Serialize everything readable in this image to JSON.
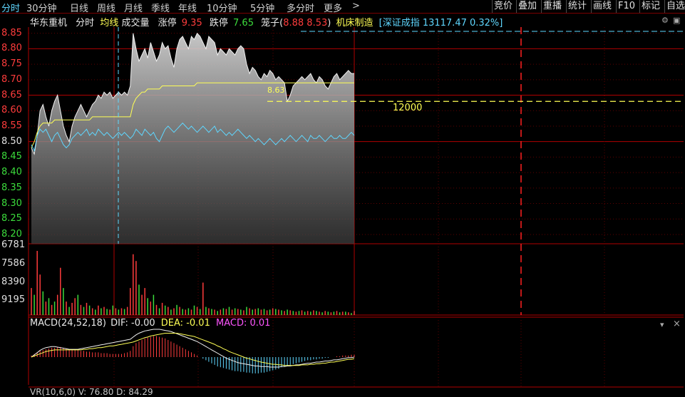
{
  "tabs": {
    "left": [
      "分时",
      "30分钟",
      "日线",
      "周线",
      "月线",
      "季线",
      "年线",
      "10分钟",
      "5分钟",
      "多分时",
      "更多",
      ">"
    ],
    "right": [
      "竞价",
      "叠加",
      "重播",
      "统计",
      "画线",
      "F10",
      "标记",
      "自选"
    ]
  },
  "info": {
    "name": "华东重机",
    "mode": "分时",
    "avg_label": "均线",
    "vol_label": "成交量",
    "limit_up_label": "涨停",
    "limit_up": "9.35",
    "limit_down_label": "跌停",
    "limit_down": "7.65",
    "cage_label": "笼子(",
    "cage_low": "8.88",
    "cage_high": "8.53",
    "cage_close": ")",
    "industry": "机床制造",
    "index_text": "[深证成指 13117.47 0.32%]"
  },
  "colors": {
    "up": "#ff3c3c",
    "down": "#3cdc3c",
    "avg": "#ffff55",
    "cyan": "#5fd7ff",
    "grid": "#b00000",
    "magenta": "#ff55ff"
  },
  "price_axis": [
    "8.85",
    "8.80",
    "8.75",
    "8.70",
    "8.65",
    "8.60",
    "8.55",
    "8.50",
    "8.45",
    "8.40",
    "8.35",
    "8.30",
    "8.25",
    "8.20"
  ],
  "volume_axis": [
    "6781",
    "7586",
    "8390",
    "9195"
  ],
  "annotations": {
    "price_mark": "8.63",
    "order_qty": "12000"
  },
  "macd": {
    "title": "MACD(24,52,18)",
    "dif_label": "DIF:",
    "dif": "-0.00",
    "dea_label": "DEA:",
    "dea": "-0.01",
    "macd_label": "MACD:",
    "macd": "0.01"
  },
  "bottom": "VR(10,6,0) V: 76.80  D: 84.29",
  "chart_data": {
    "type": "line",
    "ylim": [
      8.17,
      8.87
    ],
    "price": [
      8.48,
      8.46,
      8.52,
      8.6,
      8.62,
      8.58,
      8.55,
      8.6,
      8.63,
      8.65,
      8.6,
      8.55,
      8.52,
      8.5,
      8.55,
      8.58,
      8.6,
      8.62,
      8.6,
      8.58,
      8.6,
      8.62,
      8.63,
      8.65,
      8.64,
      8.66,
      8.65,
      8.66,
      8.64,
      8.65,
      8.66,
      8.65,
      8.66,
      8.65,
      8.68,
      8.85,
      8.8,
      8.76,
      8.78,
      8.8,
      8.77,
      8.82,
      8.79,
      8.76,
      8.78,
      8.82,
      8.8,
      8.81,
      8.77,
      8.74,
      8.8,
      8.83,
      8.84,
      8.82,
      8.8,
      8.84,
      8.83,
      8.85,
      8.84,
      8.82,
      8.8,
      8.84,
      8.83,
      8.82,
      8.78,
      8.8,
      8.79,
      8.78,
      8.8,
      8.79,
      8.78,
      8.8,
      8.81,
      8.8,
      8.75,
      8.72,
      8.74,
      8.73,
      8.71,
      8.7,
      8.72,
      8.71,
      8.73,
      8.72,
      8.7,
      8.71,
      8.7,
      8.69,
      8.63,
      8.65,
      8.68,
      8.69,
      8.7,
      8.71,
      8.7,
      8.71,
      8.72,
      8.7,
      8.69,
      8.71,
      8.7,
      8.68,
      8.67,
      8.69,
      8.71,
      8.72,
      8.7,
      8.71,
      8.72,
      8.73,
      8.72,
      8.72
    ],
    "avg": [
      8.48,
      8.5,
      8.53,
      8.55,
      8.56,
      8.56,
      8.56,
      8.56,
      8.57,
      8.57,
      8.57,
      8.57,
      8.57,
      8.57,
      8.57,
      8.57,
      8.57,
      8.57,
      8.57,
      8.57,
      8.57,
      8.58,
      8.58,
      8.58,
      8.58,
      8.58,
      8.58,
      8.58,
      8.58,
      8.58,
      8.58,
      8.58,
      8.58,
      8.58,
      8.58,
      8.62,
      8.64,
      8.65,
      8.66,
      8.66,
      8.67,
      8.67,
      8.67,
      8.67,
      8.67,
      8.68,
      8.68,
      8.68,
      8.68,
      8.68,
      8.68,
      8.68,
      8.68,
      8.68,
      8.68,
      8.68,
      8.68,
      8.69,
      8.69,
      8.69,
      8.69,
      8.69,
      8.69,
      8.69,
      8.69,
      8.69,
      8.69,
      8.69,
      8.69,
      8.69,
      8.69,
      8.69,
      8.69,
      8.69,
      8.69,
      8.69,
      8.69,
      8.69,
      8.69,
      8.69,
      8.69,
      8.69,
      8.69,
      8.69,
      8.69,
      8.69,
      8.69,
      8.69,
      8.69,
      8.69,
      8.69,
      8.69,
      8.69,
      8.69,
      8.69,
      8.69,
      8.69,
      8.69,
      8.69,
      8.69,
      8.69,
      8.69,
      8.69,
      8.69,
      8.69,
      8.69,
      8.69,
      8.69,
      8.69,
      8.69,
      8.69,
      8.69
    ],
    "index": [
      8.49,
      8.47,
      8.52,
      8.54,
      8.53,
      8.54,
      8.52,
      8.5,
      8.52,
      8.53,
      8.51,
      8.49,
      8.48,
      8.49,
      8.51,
      8.52,
      8.53,
      8.52,
      8.53,
      8.54,
      8.52,
      8.53,
      8.52,
      8.54,
      8.53,
      8.52,
      8.53,
      8.52,
      8.51,
      8.52,
      8.53,
      8.52,
      8.53,
      8.52,
      8.51,
      8.52,
      8.54,
      8.53,
      8.52,
      8.54,
      8.53,
      8.52,
      8.53,
      8.51,
      8.5,
      8.52,
      8.54,
      8.55,
      8.54,
      8.53,
      8.54,
      8.55,
      8.56,
      8.55,
      8.54,
      8.55,
      8.54,
      8.53,
      8.54,
      8.55,
      8.54,
      8.53,
      8.54,
      8.55,
      8.53,
      8.54,
      8.53,
      8.52,
      8.53,
      8.52,
      8.53,
      8.54,
      8.53,
      8.52,
      8.51,
      8.52,
      8.51,
      8.5,
      8.51,
      8.5,
      8.49,
      8.5,
      8.51,
      8.5,
      8.49,
      8.5,
      8.51,
      8.5,
      8.51,
      8.52,
      8.51,
      8.5,
      8.51,
      8.52,
      8.51,
      8.5,
      8.52,
      8.51,
      8.51,
      8.52,
      8.51,
      8.5,
      8.51,
      8.52,
      8.51,
      8.51,
      8.52,
      8.51,
      8.51,
      8.52,
      8.53,
      8.52
    ],
    "volume": [
      40,
      30,
      95,
      60,
      35,
      20,
      25,
      15,
      20,
      30,
      70,
      40,
      20,
      12,
      18,
      25,
      30,
      15,
      12,
      18,
      14,
      10,
      8,
      14,
      10,
      12,
      9,
      8,
      14,
      10,
      8,
      10,
      9,
      12,
      40,
      90,
      80,
      45,
      30,
      40,
      25,
      20,
      30,
      15,
      10,
      18,
      14,
      12,
      8,
      10,
      15,
      12,
      9,
      8,
      10,
      8,
      14,
      12,
      9,
      48,
      12,
      10,
      9,
      8,
      6,
      8,
      10,
      9,
      12,
      8,
      10,
      9,
      8,
      7,
      12,
      10,
      8,
      9,
      10,
      8,
      9,
      7,
      8,
      10,
      9,
      8,
      7,
      6,
      8,
      7,
      6,
      5,
      6,
      7,
      5,
      6,
      5,
      7,
      6,
      5,
      4,
      6,
      5,
      4,
      5,
      6,
      4,
      5,
      5,
      4,
      3,
      6
    ],
    "volume_up": [
      true,
      false,
      true,
      true,
      false,
      true,
      false,
      true,
      false,
      true,
      true,
      false,
      true,
      false,
      true,
      true,
      false,
      true,
      false,
      true,
      false,
      true,
      false,
      true,
      false,
      true,
      false,
      true,
      false,
      true,
      false,
      true,
      false,
      true,
      true,
      true,
      true,
      false,
      true,
      true,
      false,
      true,
      false,
      true,
      false,
      true,
      false,
      true,
      false,
      true,
      false,
      true,
      false,
      true,
      false,
      true,
      false,
      true,
      false,
      true,
      false,
      true,
      false,
      true,
      false,
      true,
      false,
      true,
      false,
      true,
      false,
      true,
      false,
      true,
      false,
      true,
      false,
      true,
      false,
      true,
      false,
      true,
      false,
      true,
      false,
      true,
      false,
      true,
      false,
      true,
      false,
      true,
      false,
      true,
      false,
      true,
      false,
      true,
      false,
      true,
      false,
      true,
      false,
      true,
      false,
      true,
      false,
      true,
      false,
      true,
      false,
      true
    ],
    "macd_hist": [
      0.002,
      0.004,
      0.006,
      0.008,
      0.009,
      0.01,
      0.011,
      0.012,
      0.012,
      0.013,
      0.013,
      0.012,
      0.011,
      0.01,
      0.01,
      0.009,
      0.009,
      0.008,
      0.008,
      0.007,
      0.007,
      0.006,
      0.006,
      0.006,
      0.005,
      0.005,
      0.005,
      0.004,
      0.004,
      0.004,
      0.004,
      0.004,
      0.005,
      0.006,
      0.008,
      0.014,
      0.018,
      0.02,
      0.022,
      0.024,
      0.025,
      0.026,
      0.027,
      0.027,
      0.026,
      0.025,
      0.024,
      0.022,
      0.02,
      0.018,
      0.016,
      0.014,
      0.012,
      0.01,
      0.008,
      0.006,
      0.004,
      0.002,
      0.0,
      -0.002,
      -0.004,
      -0.006,
      -0.008,
      -0.01,
      -0.012,
      -0.013,
      -0.014,
      -0.015,
      -0.016,
      -0.017,
      -0.018,
      -0.018,
      -0.019,
      -0.019,
      -0.02,
      -0.02,
      -0.021,
      -0.021,
      -0.021,
      -0.02,
      -0.02,
      -0.019,
      -0.018,
      -0.017,
      -0.016,
      -0.015,
      -0.013,
      -0.012,
      -0.011,
      -0.01,
      -0.009,
      -0.008,
      -0.007,
      -0.006,
      -0.005,
      -0.004,
      -0.004,
      -0.003,
      -0.003,
      -0.002,
      -0.002,
      -0.001,
      -0.001,
      0.0,
      0.0,
      0.001,
      0.001,
      0.002,
      0.002,
      0.002,
      0.003,
      0.003
    ],
    "macd_dif": [
      0.0,
      0.004,
      0.008,
      0.012,
      0.015,
      0.017,
      0.018,
      0.019,
      0.019,
      0.018,
      0.017,
      0.016,
      0.015,
      0.014,
      0.014,
      0.014,
      0.014,
      0.015,
      0.016,
      0.017,
      0.018,
      0.019,
      0.02,
      0.021,
      0.022,
      0.023,
      0.024,
      0.025,
      0.026,
      0.027,
      0.028,
      0.029,
      0.03,
      0.031,
      0.032,
      0.036,
      0.04,
      0.043,
      0.045,
      0.047,
      0.048,
      0.049,
      0.05,
      0.05,
      0.05,
      0.049,
      0.048,
      0.047,
      0.046,
      0.044,
      0.042,
      0.04,
      0.038,
      0.036,
      0.034,
      0.032,
      0.03,
      0.028,
      0.025,
      0.022,
      0.019,
      0.016,
      0.013,
      0.01,
      0.007,
      0.004,
      0.001,
      -0.002,
      -0.004,
      -0.006,
      -0.008,
      -0.01,
      -0.011,
      -0.012,
      -0.013,
      -0.014,
      -0.015,
      -0.016,
      -0.016,
      -0.017,
      -0.017,
      -0.017,
      -0.018,
      -0.018,
      -0.018,
      -0.018,
      -0.017,
      -0.017,
      -0.016,
      -0.016,
      -0.015,
      -0.014,
      -0.014,
      -0.013,
      -0.012,
      -0.011,
      -0.011,
      -0.01,
      -0.009,
      -0.009,
      -0.008,
      -0.007,
      -0.007,
      -0.006,
      -0.005,
      -0.005,
      -0.004,
      -0.003,
      -0.002,
      -0.001,
      -0.001,
      0.0
    ],
    "macd_dea": [
      0.0,
      0.002,
      0.004,
      0.006,
      0.008,
      0.01,
      0.011,
      0.012,
      0.013,
      0.013,
      0.013,
      0.013,
      0.013,
      0.013,
      0.013,
      0.013,
      0.013,
      0.013,
      0.014,
      0.014,
      0.015,
      0.015,
      0.016,
      0.017,
      0.017,
      0.018,
      0.019,
      0.02,
      0.02,
      0.021,
      0.022,
      0.023,
      0.024,
      0.025,
      0.026,
      0.027,
      0.029,
      0.031,
      0.033,
      0.035,
      0.036,
      0.038,
      0.039,
      0.04,
      0.041,
      0.042,
      0.043,
      0.043,
      0.043,
      0.043,
      0.043,
      0.042,
      0.041,
      0.04,
      0.039,
      0.038,
      0.037,
      0.035,
      0.033,
      0.031,
      0.029,
      0.027,
      0.025,
      0.023,
      0.02,
      0.018,
      0.015,
      0.013,
      0.01,
      0.008,
      0.006,
      0.004,
      0.002,
      0.0,
      -0.002,
      -0.003,
      -0.005,
      -0.006,
      -0.008,
      -0.009,
      -0.01,
      -0.011,
      -0.012,
      -0.013,
      -0.013,
      -0.014,
      -0.014,
      -0.015,
      -0.015,
      -0.015,
      -0.015,
      -0.015,
      -0.015,
      -0.014,
      -0.014,
      -0.014,
      -0.013,
      -0.013,
      -0.012,
      -0.012,
      -0.011,
      -0.011,
      -0.01,
      -0.009,
      -0.009,
      -0.008,
      -0.007,
      -0.006,
      -0.005,
      -0.004,
      -0.004,
      -0.003
    ]
  }
}
